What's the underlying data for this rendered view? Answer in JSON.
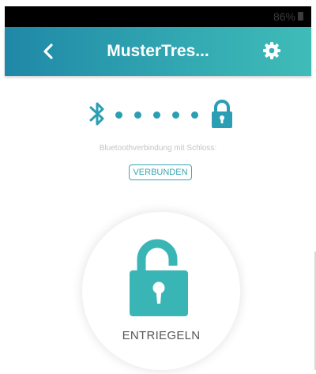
{
  "status_bar": {
    "battery_text": "86%"
  },
  "app_bar": {
    "title": "MusterTres...",
    "back_icon": "chevron-left-icon",
    "settings_icon": "gear-icon"
  },
  "connection": {
    "bluetooth_icon": "bluetooth-icon",
    "lock_icon": "lock-icon",
    "label": "Bluetoothverbindung mit Schloss:",
    "status": "VERBUNDEN"
  },
  "unlock": {
    "icon": "unlocked-padlock-icon",
    "label": "ENTRIEGELN"
  },
  "colors": {
    "accent": "#2a9fb3",
    "app_bar_start": "#1f88a7",
    "app_bar_end": "#3fbcb8",
    "lock_teal": "#3ab5b5",
    "hint_text": "#c4c4c4"
  }
}
